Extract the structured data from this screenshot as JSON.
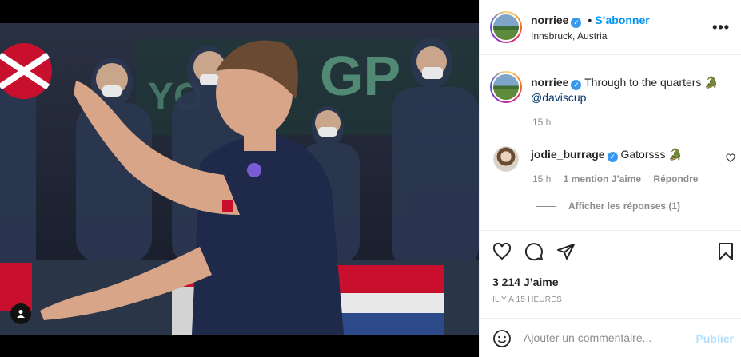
{
  "post": {
    "username": "norriee",
    "follow_label": "S’abonner",
    "dot": "•",
    "location": "Innsbruck, Austria",
    "more_icon": "more-horizontal-icon",
    "more_glyph": "•••"
  },
  "caption": {
    "username": "norriee",
    "text": " Through to the quarters 🐊",
    "mention": "@daviscup",
    "time": "15 h"
  },
  "comment": {
    "username": "jodie_burrage",
    "text": " Gatorsss 🐊",
    "time": "15 h",
    "likes": "1 mention J’aime",
    "reply": "Répondre",
    "view_replies": "Afficher les réponses (1)"
  },
  "actions": {
    "likes": "3 214 J’aime",
    "ago": "IL Y A 15 HEURES",
    "icons": [
      "heart-icon",
      "comment-icon",
      "share-icon",
      "save-icon"
    ]
  },
  "comment_box": {
    "placeholder": "Ajouter un commentaire...",
    "publish": "Publier"
  },
  "colors": {
    "accent": "#0095f6",
    "verified": "#3897f0",
    "muted": "#8e8e8e",
    "publish_disabled": "#b2dffc"
  }
}
